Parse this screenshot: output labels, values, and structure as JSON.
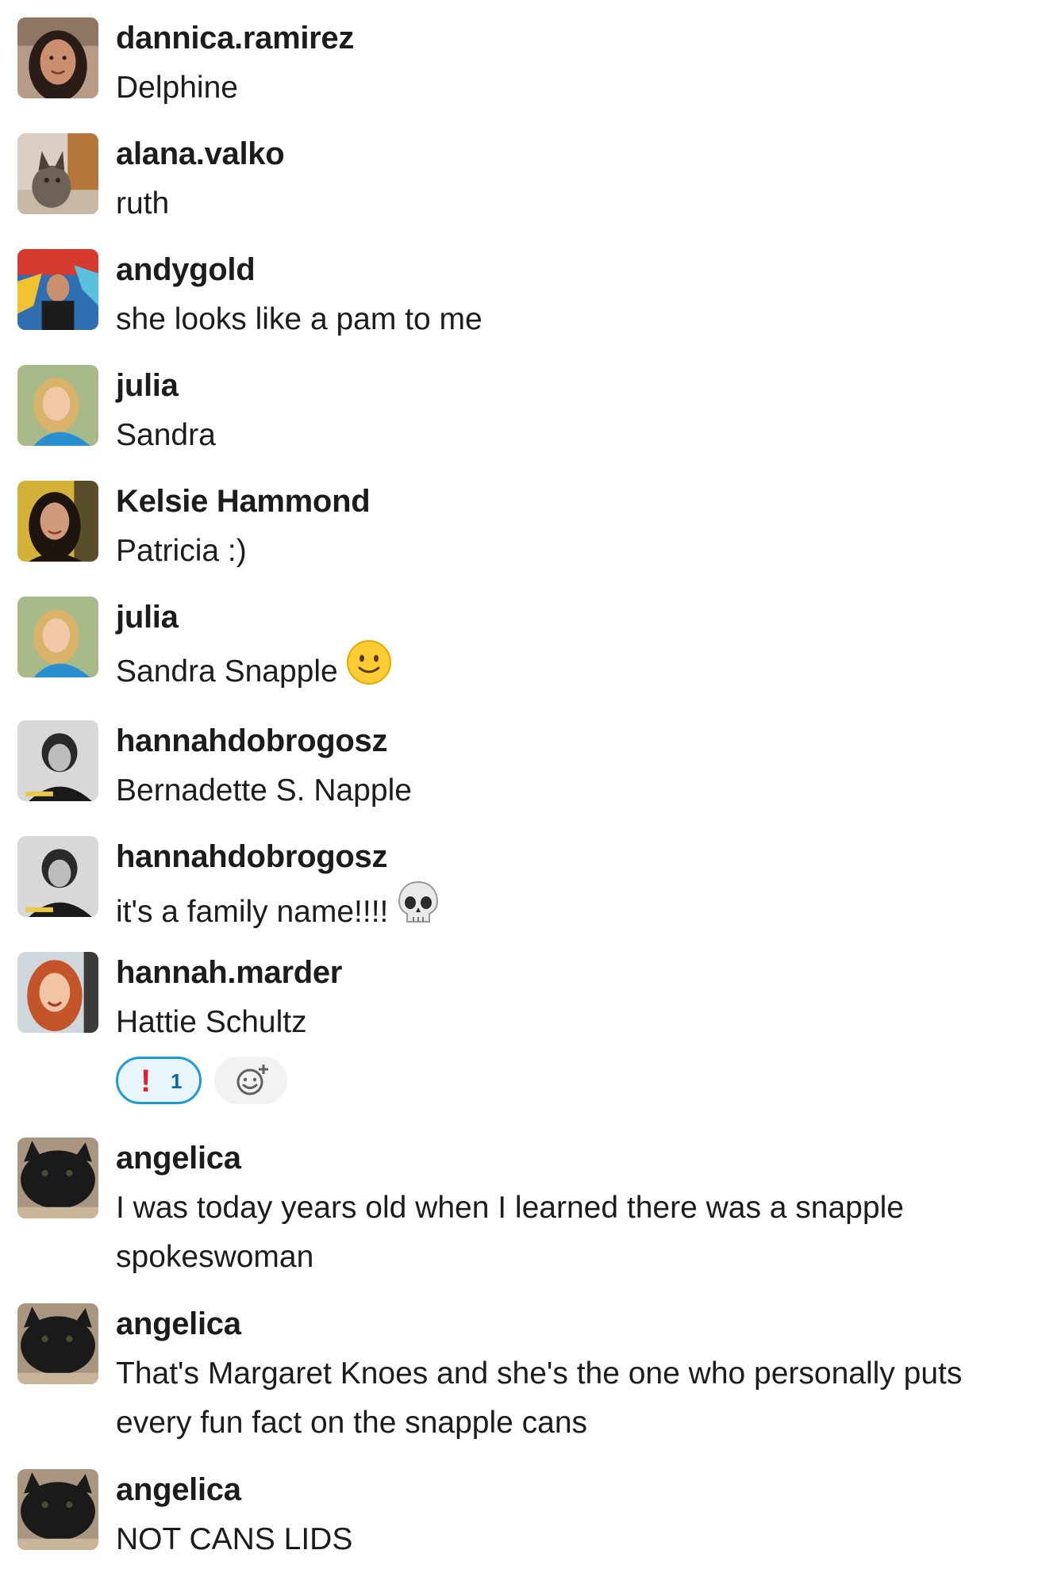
{
  "messages": [
    {
      "user": "dannica.ramirez",
      "text": "Delphine",
      "avatar": "dannica-avatar"
    },
    {
      "user": "alana.valko",
      "text": "ruth",
      "avatar": "cat-avatar"
    },
    {
      "user": "andygold",
      "text": "she looks like a pam to me",
      "avatar": "andygold-avatar"
    },
    {
      "user": "julia",
      "text": "Sandra",
      "avatar": "julia-avatar"
    },
    {
      "user": "Kelsie Hammond",
      "text": "Patricia :)",
      "avatar": "kelsie-avatar"
    },
    {
      "user": "julia",
      "text": "Sandra Snapple",
      "emoji": "slightly-smiling-face-icon",
      "avatar": "julia-avatar"
    },
    {
      "user": "hannahdobrogosz",
      "text": "Bernadette S. Napple",
      "avatar": "hannah-bw-avatar"
    },
    {
      "user": "hannahdobrogosz",
      "text": "it's a family name!!!!",
      "emoji": "skull-icon",
      "avatar": "hannah-bw-avatar"
    },
    {
      "user": "hannah.marder",
      "text": "Hattie Schultz",
      "avatar": "redhead-avatar",
      "reaction": {
        "emoji": "!",
        "count": "1",
        "icon": "exclamation-icon"
      }
    },
    {
      "user": "angelica",
      "text": "I was today years old when I learned there was a snapple spokeswoman",
      "avatar": "black-cat-avatar"
    },
    {
      "user": "angelica",
      "text": "That's Margaret Knoes and she's the one who personally puts every fun fact on the snapple cans",
      "avatar": "black-cat-avatar"
    },
    {
      "user": "angelica",
      "text": "NOT CANS LIDS",
      "avatar": "black-cat-avatar"
    }
  ],
  "colors": {
    "text": "#1d1c1d",
    "reaction_border": "#1d9bd1",
    "reaction_bg": "#e8f5fa",
    "reaction_count": "#1264a3",
    "exclamation": "#e01e2e"
  }
}
